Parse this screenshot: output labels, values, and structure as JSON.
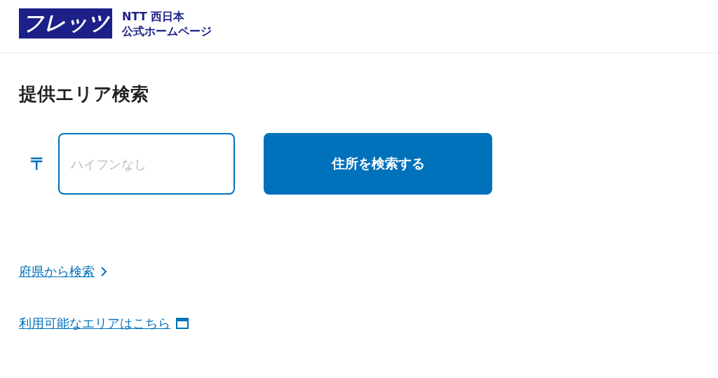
{
  "header": {
    "logo": "フレッツ",
    "company": "NTT 西日本",
    "subtitle": "公式ホームページ"
  },
  "title": "提供エリア検索",
  "search": {
    "postal_mark": "〒",
    "placeholder": "ハイフンなし",
    "button": "住所を検索する"
  },
  "links": [
    {
      "label": "府県から検索",
      "kind": "chevron"
    },
    {
      "label": "利用可能なエリアはこちら",
      "kind": "external"
    }
  ]
}
